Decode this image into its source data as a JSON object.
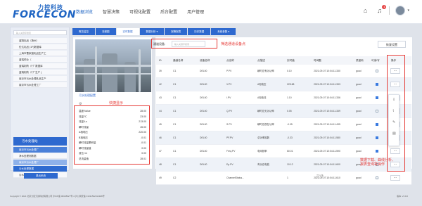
{
  "header": {
    "logo_cn": "力控科技",
    "logo_en": "FORCECON",
    "nav": [
      "数据浏览",
      "智慧决策",
      "可视化配置",
      "后台配置",
      "用户管理"
    ],
    "notification_count": "1"
  },
  "sidebar": {
    "search_placeholder": "输入关键字搜索",
    "items": [
      "蓝翔乳品（扬州）",
      "伦达乳品 (1F)数据库",
      "上海市曹家渡乳品生产工",
      "蓝瑞药业（",
      "蓝瑞制药（F厂数据库",
      "蓝瑞制药（F厂生产 (",
      "南京市污水处理乳品生产",
      "南京市污水处理工厂"
    ],
    "section_title": "污水处理站",
    "sub_items": [
      "南京市污水处理厂",
      "净水处理测数据",
      "南京市污水处理厂",
      "污水处理数据",
      "污水处理设备数据"
    ],
    "footer_button": "退出系统"
  },
  "tabs": [
    "概览监控",
    "流程图",
    "实时数据",
    "数据分析 ▾",
    "报警报表",
    "历史数据",
    "系统参数 ▾"
  ],
  "left_panel": {
    "title": "污水处理配置",
    "kv": [
      {
        "k": "温度/Value",
        "v": "28.00"
      },
      {
        "k": "流量/℃",
        "v": "23.00"
      },
      {
        "k": "流量/Ls",
        "v": "213.00"
      },
      {
        "k": "瞬时流量",
        "v": "45.00"
      },
      {
        "k": "A相电压",
        "v": "220.00"
      },
      {
        "k": "B相电压",
        "v": "-0.01"
      },
      {
        "k": "瞬时流量累积量",
        "v": "-0.01"
      },
      {
        "k": "瞬时流量值",
        "v": "0.00"
      },
      {
        "k": "液位 /m",
        "v": "0.00"
      },
      {
        "k": "总流量值",
        "v": "28.01"
      }
    ]
  },
  "annotations": {
    "filter_hint": "筛选通道设备点",
    "kv_hint": "快捷显示",
    "op_hint": "数据下载、曲线分析、\n报表查询等操作"
  },
  "filter": {
    "label": "通道设备:",
    "placeholder": "输入关键字搜索",
    "reset_button": "恢复设置"
  },
  "table": {
    "headers": [
      "ID",
      "通道名称",
      "设备名称",
      "点名称",
      "点描述",
      "实时值",
      "时间戳",
      "质量码",
      "可读/写",
      "操作"
    ],
    "rows": [
      {
        "id": "39",
        "ch": "C1",
        "dev": "DEL00",
        "pt": "P.PV",
        "desc": "瞬时总有功功率",
        "val": "0.10",
        "ts": "2021-09-07 10:04:11.330",
        "q": "good",
        "rw": false
      },
      {
        "id": "42",
        "ch": "C1",
        "dev": "DEL00",
        "pt": "V.PV",
        "desc": "A相电压",
        "val": "225.68",
        "ts": "2021-09-07 10:04:11.333",
        "q": "good",
        "rw": true
      },
      {
        "id": "43",
        "ch": "C1",
        "dev": "DEL00",
        "pt": "I.PV",
        "desc": "A相电流",
        "val": "1.10",
        "ts": "2021-09-07 10:04:11.336",
        "q": "good",
        "rw": true
      },
      {
        "id": "44",
        "ch": "C1",
        "dev": "DEL00",
        "pt": "Q.PV",
        "desc": "瞬时总无功功率",
        "val": "0.05",
        "ts": "2021-09-07 10:04:11.339",
        "q": "good",
        "rw": false
      },
      {
        "id": "45",
        "ch": "C1",
        "dev": "DEL00",
        "pt": "S.PV",
        "desc": "瞬时总视在功率",
        "val": "-0.05",
        "ts": "2021-09-07 10:04:11.435",
        "q": "good",
        "rw": true
      },
      {
        "id": "46",
        "ch": "C1",
        "dev": "DEL00",
        "pt": "PF.PV",
        "desc": "总功率因数",
        "val": "-0.33",
        "ts": "2021-09-07 10:04:11.580",
        "q": "good",
        "rw": true
      },
      {
        "id": "47",
        "ch": "C1",
        "dev": "DEL00",
        "pt": "Freq.PV",
        "desc": "电网频率",
        "val": "60.01",
        "ts": "2021-09-07 10:04:11.590",
        "q": "good",
        "rw": true
      },
      {
        "id": "48",
        "ch": "C1",
        "dev": "DEL00",
        "pt": "Ep.PV",
        "desc": "有功总电能",
        "val": "10.12",
        "ts": "2021-09-07 10:04:11.600",
        "q": "good",
        "rw": false
      },
      {
        "id": "49",
        "ch": "C2",
        "dev": "",
        "pt": "ChannelStatus...",
        "desc": "",
        "val": "1",
        "ts": "2021-09-07 10:04:11.610",
        "q": "good",
        "rw": false
      }
    ]
  },
  "page_info": "共 9 条",
  "footer": {
    "copyright": "Copyright © 2021 北京力控元通科技有限公司  沪ICP备 06028927号-4  沪公网安备 31011502014928号",
    "version": "版本: v3.0.0"
  },
  "colors": {
    "accent": "#2e69cf",
    "annotation": "#e53935"
  }
}
